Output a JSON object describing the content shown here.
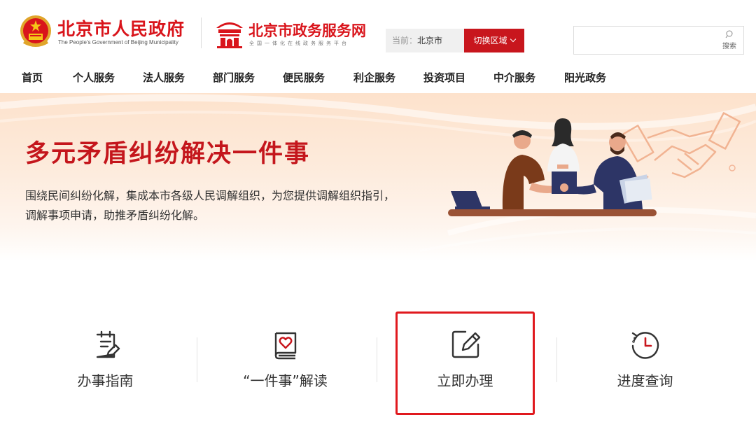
{
  "header": {
    "gov_title": "北京市人民政府",
    "gov_subtitle": "The People's Government of Beijing Municipality",
    "service_title": "北京市政务服务网",
    "service_subtitle": "全国一体化在线政务服务平台",
    "region_prefix": "当前：",
    "region_value": "北京市",
    "switch_region_label": "切换区域",
    "search_placeholder": "",
    "search_label": "搜索"
  },
  "nav": {
    "items": [
      {
        "label": "首页"
      },
      {
        "label": "个人服务"
      },
      {
        "label": "法人服务"
      },
      {
        "label": "部门服务"
      },
      {
        "label": "便民服务"
      },
      {
        "label": "利企服务"
      },
      {
        "label": "投资项目"
      },
      {
        "label": "中介服务"
      },
      {
        "label": "阳光政务"
      }
    ]
  },
  "banner": {
    "title": "多元矛盾纠纷解决一件事",
    "description_line1": "围绕民间纠纷化解，集成本市各级人民调解组织，为您提供调解组织指引，",
    "description_line2": "调解事项申请，助推矛盾纠纷化解。"
  },
  "services": {
    "items": [
      {
        "label": "办事指南",
        "icon": "clipboard-edit-icon"
      },
      {
        "label": "“一件事”解读",
        "icon": "book-heart-icon"
      },
      {
        "label": "立即办理",
        "icon": "edit-square-icon"
      },
      {
        "label": "进度查询",
        "icon": "clock-history-icon"
      }
    ]
  },
  "colors": {
    "brand_red": "#d9141b",
    "button_red": "#c8161d",
    "highlight_red": "#e0191e"
  }
}
